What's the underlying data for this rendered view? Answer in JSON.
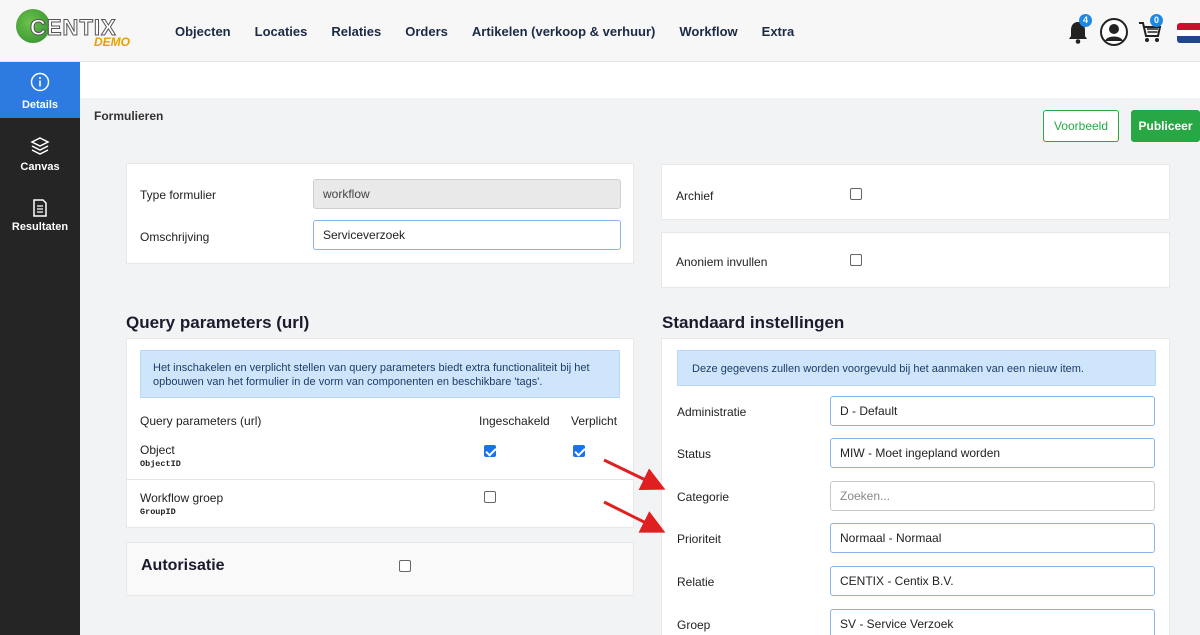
{
  "brand": {
    "logo_text": "CENTIX",
    "demo_label": "DEMO"
  },
  "nav": [
    "Objecten",
    "Locaties",
    "Relaties",
    "Orders",
    "Artikelen (verkoop & verhuur)",
    "Workflow",
    "Extra"
  ],
  "notifications": {
    "bell_count": "4",
    "cart_count": "0"
  },
  "sidebar": [
    {
      "label": "Details",
      "icon": "info-icon",
      "active": true
    },
    {
      "label": "Canvas",
      "icon": "layers-icon",
      "active": false
    },
    {
      "label": "Resultaten",
      "icon": "document-icon",
      "active": false
    }
  ],
  "page": {
    "title": "Formulieren",
    "preview_button": "Voorbeeld",
    "publish_button": "Publiceer"
  },
  "form": {
    "type_label": "Type formulier",
    "type_value": "workflow",
    "desc_label": "Omschrijving",
    "desc_value": "Serviceverzoek",
    "archive_label": "Archief",
    "archive_checked": false,
    "anon_label": "Anoniem invullen",
    "anon_checked": false
  },
  "query": {
    "title": "Query parameters (url)",
    "info": "Het inschakelen en verplicht stellen van query parameters biedt extra functionaliteit bij het opbouwen van het formulier in de vorm van componenten en beschikbare 'tags'.",
    "col_param": "Query parameters (url)",
    "col_enabled": "Ingeschakeld",
    "col_required": "Verplicht",
    "rows": [
      {
        "name": "Object",
        "code": "ObjectID",
        "enabled": true,
        "required": true
      },
      {
        "name": "Workflow groep",
        "code": "GroupID",
        "enabled": false,
        "required": false
      }
    ]
  },
  "auth": {
    "title": "Autorisatie",
    "checked": false
  },
  "defaults": {
    "title": "Standaard instellingen",
    "info": "Deze gegevens zullen worden voorgevuld bij het aanmaken van een nieuw item.",
    "fields": [
      {
        "label": "Administratie",
        "value": "D - Default",
        "placeholder": false
      },
      {
        "label": "Status",
        "value": "MIW - Moet ingepland worden",
        "placeholder": false
      },
      {
        "label": "Categorie",
        "value": "Zoeken...",
        "placeholder": true
      },
      {
        "label": "Prioriteit",
        "value": "Normaal - Normaal",
        "placeholder": false
      },
      {
        "label": "Relatie",
        "value": "CENTIX - Centix B.V.",
        "placeholder": false
      },
      {
        "label": "Groep",
        "value": "SV - Service Verzoek",
        "placeholder": false
      }
    ]
  },
  "colors": {
    "accent": "#2d7be0",
    "green": "#28a745",
    "sidebar": "#252525",
    "arrow": "#e02020"
  }
}
